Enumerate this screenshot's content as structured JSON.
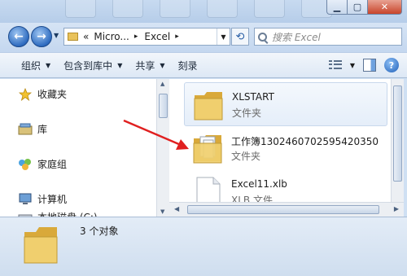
{
  "address": {
    "prefix": "«",
    "segments": [
      "Micro...",
      "Excel"
    ],
    "separator": "▸"
  },
  "search": {
    "placeholder": "搜索 Excel"
  },
  "toolbar": {
    "organize": "组织",
    "include_in_library": "包含到库中",
    "share": "共享",
    "burn": "刻录"
  },
  "nav": {
    "items": [
      {
        "label": "收藏夹",
        "icon": "star-icon"
      },
      {
        "label": "库",
        "icon": "library-icon"
      },
      {
        "label": "家庭组",
        "icon": "homegroup-icon"
      },
      {
        "label": "计算机",
        "icon": "computer-icon"
      },
      {
        "label": "本地磁盘 (C:)",
        "icon": "drive-icon"
      }
    ]
  },
  "files": [
    {
      "name": "XLSTART",
      "type": "文件夹",
      "icon": "folder-icon"
    },
    {
      "name": "工作簿1302460702595420350",
      "type": "文件夹",
      "icon": "folder-icon"
    },
    {
      "name": "Excel11.xlb",
      "type": "XLB 文件",
      "icon": "document-icon"
    }
  ],
  "details": {
    "count_text": "3 个对象"
  },
  "colors": {
    "annotation_arrow": "#e02020",
    "folder": "#e9c25a"
  }
}
